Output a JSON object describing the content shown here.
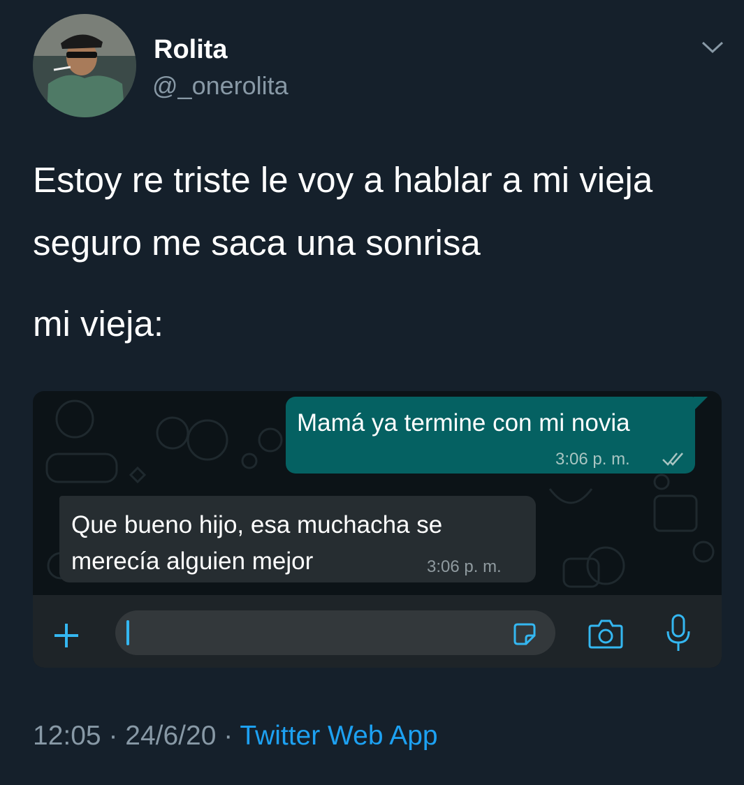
{
  "author": {
    "name": "Rolita",
    "handle": "@_onerolita"
  },
  "tweet_text": {
    "line1": "Estoy re triste le voy a hablar a mi vieja",
    "line2": "seguro me saca una sonrisa",
    "line3": "mi vieja:"
  },
  "chat": {
    "outgoing": {
      "text": "Mamá ya termine con mi novia",
      "time": "3:06 p. m."
    },
    "incoming": {
      "line1": "Que bueno hijo, esa muchacha se",
      "line2": "merecía alguien mejor",
      "time": "3:06 p. m."
    }
  },
  "footer": {
    "time": "12:05",
    "separator": " · ",
    "date": "24/6/20",
    "app": "Twitter Web App"
  },
  "icons": [
    "chevron-down-icon",
    "plus-icon",
    "sticker-icon",
    "camera-icon",
    "mic-icon",
    "double-check-icon"
  ],
  "colors": {
    "background": "#15202b",
    "outgoing_bubble": "#056162",
    "incoming_bubble": "#262d31",
    "accent": "#34b7f1",
    "link": "#1da1f2"
  }
}
